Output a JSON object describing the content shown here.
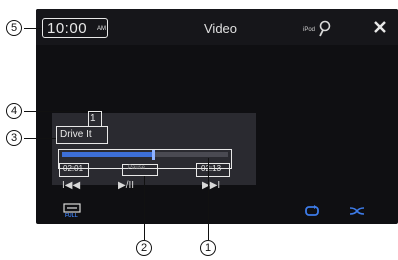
{
  "header": {
    "clock_time": "10:00",
    "clock_ampm": "AM",
    "title": "Video",
    "ipod_label": "iPod",
    "search_icon": "search-icon",
    "close_icon": "close-icon"
  },
  "now_playing": {
    "track_number": "1",
    "song_title": "Drive It",
    "elapsed": "02:01",
    "total": "02:13",
    "status": "Pause",
    "progress": 0.55
  },
  "controls": {
    "prev": "I◀◀",
    "play_pause": "▶/II",
    "next": "▶▶I",
    "full_label": "FULL",
    "repeat_icon": "repeat-icon",
    "shuffle_icon": "shuffle-icon"
  },
  "callouts": {
    "c1": "1",
    "c2": "2",
    "c3": "3",
    "c4": "4",
    "c5": "5"
  },
  "colors": {
    "background": "#0f0f12",
    "accent": "#3d6fd8",
    "text": "#e8e8e8"
  }
}
